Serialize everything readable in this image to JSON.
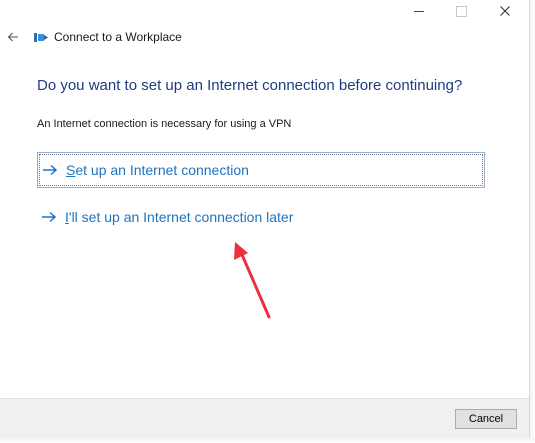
{
  "window": {
    "title": "Connect to a Workplace"
  },
  "titlebar": {
    "icons": [
      "minimize-icon",
      "maximize-icon",
      "close-icon"
    ]
  },
  "main": {
    "heading": "Do you want to set up an Internet connection before continuing?",
    "subtext": "An Internet connection is necessary for using a VPN",
    "options": [
      {
        "accel": "S",
        "label_rest": "et up an Internet connection",
        "icon": "arrow-right-icon"
      },
      {
        "accel": "I",
        "label_rest": "'ll set up an Internet connection later",
        "icon": "arrow-right-icon"
      }
    ]
  },
  "footer": {
    "cancel_label": "Cancel"
  },
  "colors": {
    "heading": "#1f3b80",
    "link": "#1e73be",
    "annotation": "#e8313a",
    "footer_bg": "#f0f0f0"
  }
}
